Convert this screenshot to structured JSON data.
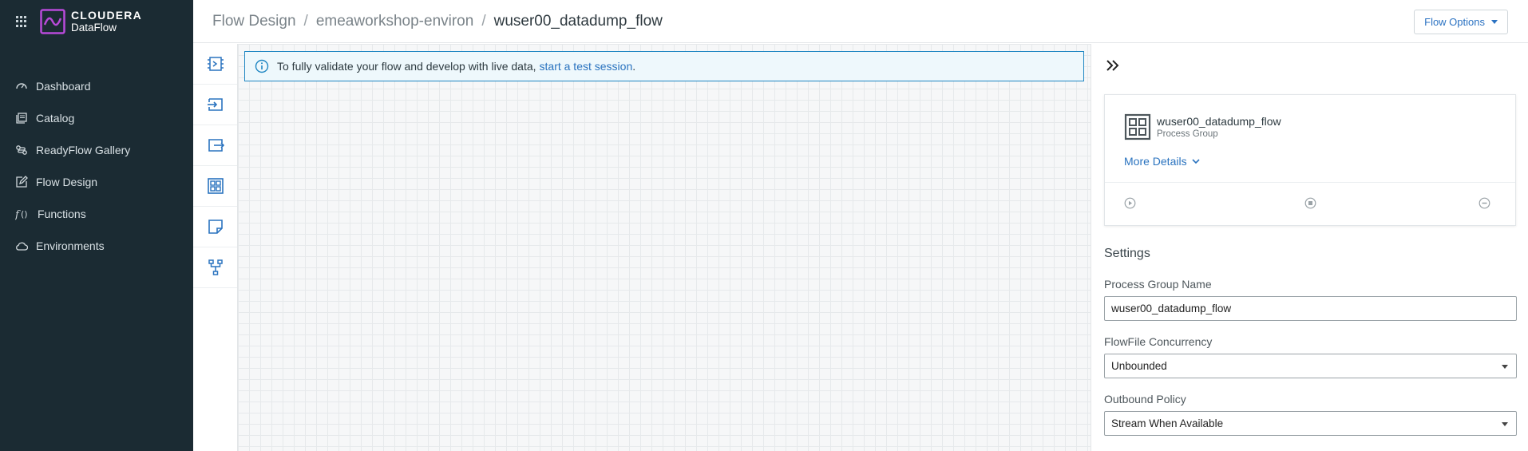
{
  "app": {
    "brand": "CLOUDERA",
    "product": "DataFlow"
  },
  "sidebar": {
    "items": [
      {
        "label": "Dashboard",
        "icon": "gauge-icon"
      },
      {
        "label": "Catalog",
        "icon": "catalog-icon"
      },
      {
        "label": "ReadyFlow Gallery",
        "icon": "readyflow-icon"
      },
      {
        "label": "Flow Design",
        "icon": "edit-icon"
      },
      {
        "label": "Functions",
        "icon": "function-icon"
      },
      {
        "label": "Environments",
        "icon": "cloud-icon"
      }
    ]
  },
  "breadcrumb": {
    "items": [
      "Flow Design",
      "emeaworkshop-environ",
      "wuser00_datadump_flow"
    ]
  },
  "header": {
    "flow_options": "Flow Options"
  },
  "banner": {
    "text": "To fully validate your flow and develop with live data,",
    "link": "start a test session",
    "suffix": "."
  },
  "panel": {
    "name": "wuser00_datadump_flow",
    "type": "Process Group",
    "more_details": "More Details",
    "settings_title": "Settings",
    "fields": {
      "pg_name_label": "Process Group Name",
      "pg_name_value": "wuser00_datadump_flow",
      "concurrency_label": "FlowFile Concurrency",
      "concurrency_value": "Unbounded",
      "outbound_label": "Outbound Policy",
      "outbound_value": "Stream When Available"
    }
  },
  "colors": {
    "sidebar_bg": "#1b2b33",
    "accent": "#2a73bf",
    "logo": "#b84ad9"
  }
}
